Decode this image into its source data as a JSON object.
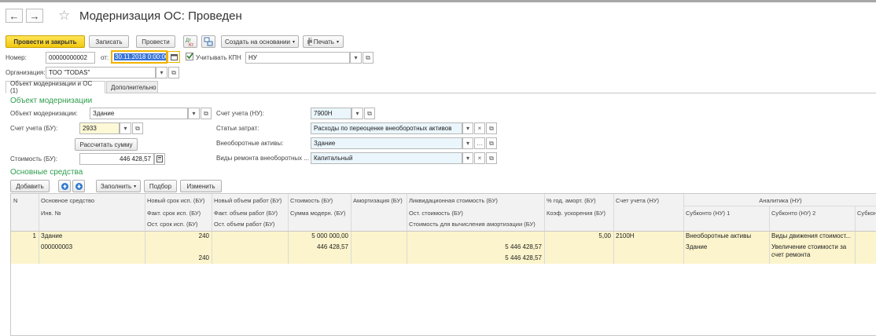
{
  "header": {
    "title": "Модернизация ОС: Проведен",
    "back_icon": "←",
    "forward_icon": "→",
    "star_icon": "☆"
  },
  "toolbar": {
    "post_close": "Провести и закрыть",
    "save": "Записать",
    "post": "Провести",
    "create_based": "Создать на основании",
    "print": "Печать"
  },
  "form": {
    "number_label": "Номер:",
    "number": "00000000002",
    "date_label": "от:",
    "date": "30.11.2018  0:00:00",
    "kpn_label": "Учитывать КПН",
    "kpn_value": "НУ",
    "org_label": "Организация:",
    "org": "ТОО \"TODAS\""
  },
  "tabs": [
    {
      "label": "Объект модернизации и ОС (1)"
    },
    {
      "label": "Дополнительно"
    }
  ],
  "obj": {
    "section": "Объект модернизации",
    "object_label": "Объект модернизации:",
    "object": "Здание",
    "acc_bu_label": "Счет учета (БУ):",
    "acc_bu": "2933",
    "calc_btn": "Рассчитать сумму",
    "cost_label": "Стоимость (БУ):",
    "cost": "446 428,57",
    "acc_nu_label": "Счет учета (НУ):",
    "acc_nu": "7900Н",
    "expense_label": "Статьи затрат:",
    "expense": "Расходы по переоценке внеоборотных активов",
    "assets_label": "Внеоборотные активы:",
    "assets": "Здание",
    "repair_label": "Виды ремонта внеоборотных ...",
    "repair": "Капитальный"
  },
  "os": {
    "section": "Основные средства",
    "add": "Добавить",
    "fill": "Заполнить",
    "pick": "Подбор",
    "change": "Изменить"
  },
  "grid": {
    "headers": {
      "n": "N",
      "c1a": "Основное средство",
      "c1b": "Инв. №",
      "c2a": "Новый срок исп. (БУ)",
      "c2b": "Факт. срок исп. (БУ)",
      "c2c": "Ост. срок исп. (БУ)",
      "c3a": "Новый объем работ (БУ)",
      "c3b": "Факт. объем работ (БУ)",
      "c3c": "Ост. объем работ (БУ)",
      "c4a": "Стоимость (БУ)",
      "c4b": "Сумма модерн. (БУ)",
      "c5a": "Амортизация (БУ)",
      "c6a": "Ликвидационная стоимость (БУ)",
      "c6b": "Ост. стоимость (БУ)",
      "c6c": "Стоимость для вычисления амортизации (БУ)",
      "c7a": "% год. аморт. (БУ)",
      "c7b": "Коэф. ускорения (БУ)",
      "c8a": "Счет учета (НУ)",
      "c9": "Аналитика (НУ)",
      "c9a": "Субконто (НУ) 1",
      "c9b": "Субконто (НУ) 2",
      "c9c": "Субконт"
    },
    "row": {
      "n": "1",
      "asset": "Здание",
      "inv": "000000003",
      "new_term": "240",
      "rest_term": "240",
      "cost": "5 000 000,00",
      "mod_sum": "446 428,57",
      "rest_cost": "5 446 428,57",
      "amort_base": "5 446 428,57",
      "rate": "5,00",
      "acc_nu": "2100Н",
      "sub1a": "Внеоборотные активы",
      "sub1b": "Здание",
      "sub2a": "Виды движения стоимост...",
      "sub2b": "Увеличение стоимости за",
      "sub2c": "счет ремонта"
    }
  }
}
